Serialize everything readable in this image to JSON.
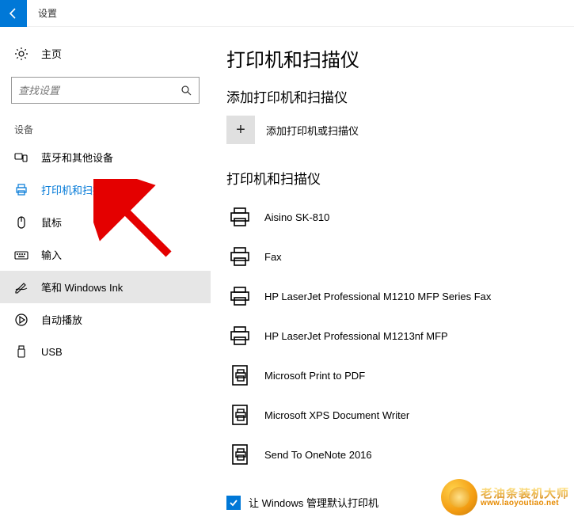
{
  "titlebar": {
    "title": "设置"
  },
  "sidebar": {
    "home": "主页",
    "search_placeholder": "查找设置",
    "group": "设备",
    "items": [
      {
        "label": "蓝牙和其他设备"
      },
      {
        "label": "打印机和扫描仪"
      },
      {
        "label": "鼠标"
      },
      {
        "label": "输入"
      },
      {
        "label": "笔和 Windows Ink"
      },
      {
        "label": "自动播放"
      },
      {
        "label": "USB"
      }
    ]
  },
  "main": {
    "heading": "打印机和扫描仪",
    "add_section": "添加打印机和扫描仪",
    "add_label": "添加打印机或扫描仪",
    "list_section": "打印机和扫描仪",
    "devices": [
      {
        "label": "Aisino SK-810"
      },
      {
        "label": "Fax"
      },
      {
        "label": "HP LaserJet Professional M1210 MFP Series Fax"
      },
      {
        "label": "HP LaserJet Professional M1213nf MFP"
      },
      {
        "label": "Microsoft Print to PDF"
      },
      {
        "label": "Microsoft XPS Document Writer"
      },
      {
        "label": "Send To OneNote 2016"
      }
    ],
    "default_checkbox": "让 Windows 管理默认打印机"
  },
  "watermark": {
    "zh": "老油条装机大师",
    "url": "www.laoyoutiao.net"
  }
}
